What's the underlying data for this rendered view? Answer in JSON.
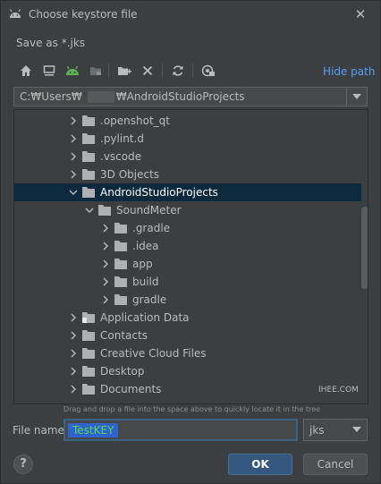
{
  "window": {
    "title": "Choose keystore file",
    "subtitle": "Save as *.jks"
  },
  "toolbar": {
    "icons": [
      "home-icon",
      "desktop-icon",
      "android-project-icon",
      "project-folder-icon",
      "new-folder-icon",
      "delete-icon",
      "refresh-icon",
      "show-hidden-icon"
    ],
    "hide_path": "Hide path"
  },
  "path": {
    "prefix": "C:₩Users₩",
    "suffix": "₩AndroidStudioProjects"
  },
  "tree": {
    "rows": [
      {
        "label": ".openshot_qt",
        "expanded": false
      },
      {
        "label": ".pylint.d",
        "expanded": false
      },
      {
        "label": ".vscode",
        "expanded": false
      },
      {
        "label": "3D Objects",
        "expanded": false
      },
      {
        "label": "AndroidStudioProjects",
        "expanded": true,
        "selected": true
      },
      {
        "label": "SoundMeter",
        "expanded": true
      },
      {
        "label": ".gradle",
        "expanded": false
      },
      {
        "label": ".idea",
        "expanded": false
      },
      {
        "label": "app",
        "expanded": false
      },
      {
        "label": "build",
        "expanded": false
      },
      {
        "label": "gradle",
        "expanded": false
      },
      {
        "label": "Application Data",
        "expanded": false
      },
      {
        "label": "Contacts",
        "expanded": false
      },
      {
        "label": "Creative Cloud Files",
        "expanded": false
      },
      {
        "label": "Desktop",
        "expanded": false
      },
      {
        "label": "Documents",
        "expanded": false
      }
    ]
  },
  "watermark": "IHEE.COM",
  "hint": "Drag and drop a file into the space above to quickly locate it in the tree",
  "file_name": {
    "label": "File name:",
    "value": "TestKEY",
    "extension": "jks"
  },
  "buttons": {
    "help": "?",
    "ok": "OK",
    "cancel": "Cancel"
  },
  "colors": {
    "accent_link": "#589df6",
    "selection": "#0d293e",
    "ok_button": "#365880",
    "android_green": "#5ab552"
  }
}
